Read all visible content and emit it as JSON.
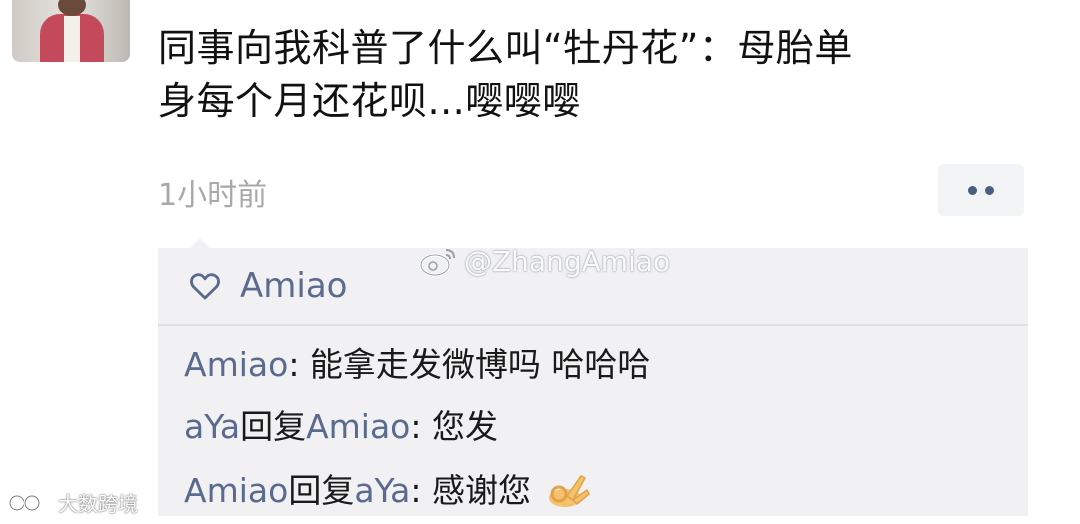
{
  "post": {
    "line1": "同事向我科普了什么叫“牡丹花”：母胎单",
    "line2": "身每个月还花呗...嘤嘤嘤",
    "time": "1小时前"
  },
  "likes": {
    "names": "Amiao"
  },
  "comments": [
    {
      "author": "Amiao",
      "reply_word": "",
      "target": "",
      "text": ": 能拿走发微博吗 哈哈哈"
    },
    {
      "author": "aYa",
      "reply_word": "回复",
      "target": "Amiao",
      "text": ": 您发"
    },
    {
      "author": "Amiao",
      "reply_word": "回复",
      "target": "aYa",
      "text": ": 感谢您"
    }
  ],
  "watermark": {
    "text": "@ZhangAmiao"
  },
  "site_logo": {
    "text": "大数跨境"
  },
  "icons": {
    "heart": "heart-icon",
    "more": "more-dots-icon",
    "emoji": "ok-hand-emoji-icon",
    "weibo": "weibo-icon"
  },
  "colors": {
    "name_blue": "#5a6b8e",
    "comment_bg": "#f1f1f3",
    "time_gray": "#a9a9a9"
  }
}
